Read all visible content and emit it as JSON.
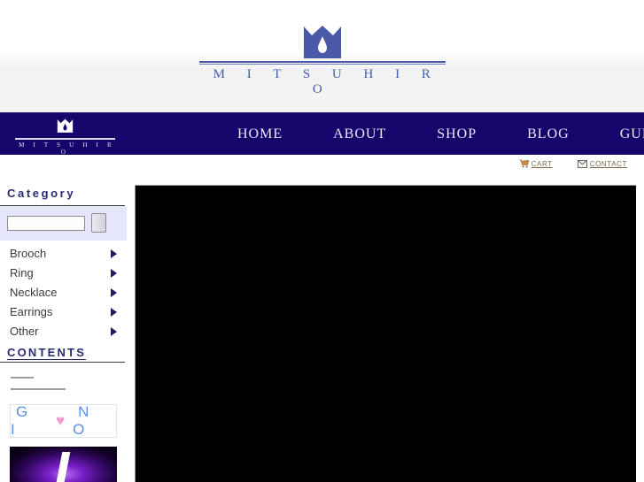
{
  "site": {
    "brand_word": "M I T S U H I R O",
    "brand_word_small": "M I T S U H I R O",
    "accent_navy": "#16056b",
    "logo_blue": "#4a5aa8",
    "lavender": "#e6e6fa"
  },
  "nav": {
    "items": [
      {
        "label": "HOME"
      },
      {
        "label": "ABOUT"
      },
      {
        "label": "SHOP"
      },
      {
        "label": "BLOG"
      },
      {
        "label": "GUIDE"
      }
    ]
  },
  "utility": {
    "cart": {
      "label": "CART",
      "icon": "shopping-cart-icon"
    },
    "contact": {
      "label": "CONTACT",
      "icon": "envelope-icon"
    }
  },
  "sidebar": {
    "category_title": "Category",
    "search": {
      "value": "",
      "placeholder": "",
      "button_label": ""
    },
    "categories": [
      {
        "label": "Brooch"
      },
      {
        "label": "Ring"
      },
      {
        "label": "Necklace"
      },
      {
        "label": "Earrings"
      },
      {
        "label": "Other"
      }
    ],
    "contents_title": "CONTENTS",
    "banners": [
      {
        "name": "givno-banner",
        "text_left": "G I",
        "heart": "♥",
        "text_right": "N O"
      },
      {
        "name": "purple-banner",
        "text": ""
      }
    ]
  },
  "main": {
    "content_label": ""
  }
}
